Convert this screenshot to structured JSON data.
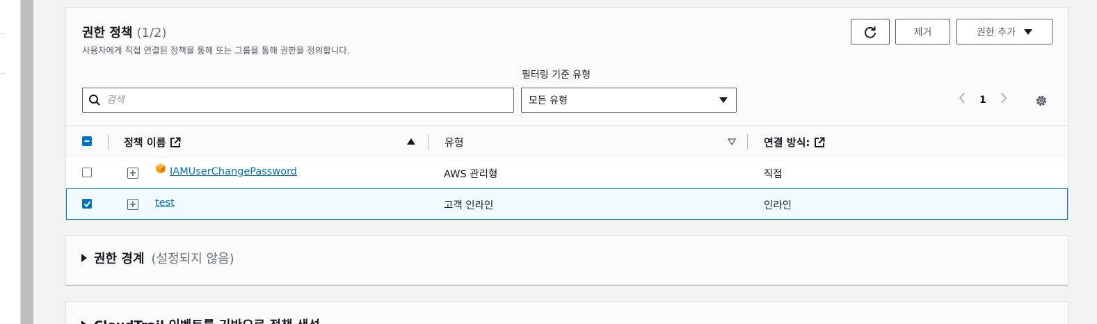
{
  "policies_panel": {
    "title": "권한 정책",
    "count": "(1/2)",
    "description": "사용자에게 직접 연결된 정책을 통해 또는 그룹을 통해 권한을 정의합니다.",
    "refresh_icon": "refresh-icon",
    "remove_label": "제거",
    "add_label": "권한 추가",
    "filter_label": "필터링 기준 유형",
    "search_placeholder": "검색",
    "filter_selected": "모든 유형",
    "page_number": "1",
    "columns": {
      "name": "정책 이름",
      "type": "유형",
      "attached": "연결 방식:"
    },
    "rows": [
      {
        "name": "IAMUserChangePassword",
        "type": "AWS 관리형",
        "attached": "직접",
        "checked": false,
        "icon": "aws-managed-icon"
      },
      {
        "name": "test",
        "type": "고객 인라인",
        "attached": "인라인",
        "checked": true
      }
    ]
  },
  "boundary_panel": {
    "title": "권한 경계",
    "status": "(설정되지 않음)"
  },
  "cloudtrail_panel": {
    "title": "CloudTrail 이벤트를 기반으로 정책 생성"
  },
  "colors": {
    "accent": "#0073bb",
    "aws_orange": "#ff9900",
    "border": "#545b64"
  }
}
